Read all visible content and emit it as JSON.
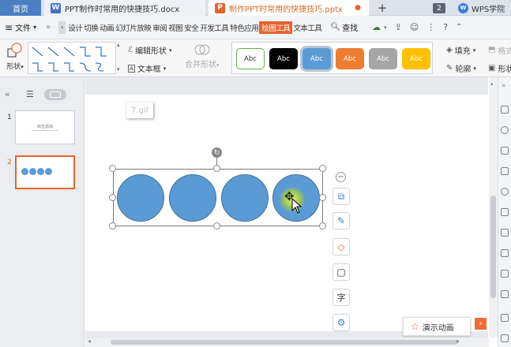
{
  "tabs": {
    "home": "首页",
    "docx": "PPT制作时常用的快捷技巧.docx",
    "pptx": "制作PPT时常用的快捷技巧.pptx",
    "count": "2",
    "wps": "WPS学院"
  },
  "menu": {
    "file": "文件",
    "tabs": [
      "设计",
      "切换",
      "动画",
      "幻灯片放映",
      "审阅",
      "视图",
      "安全",
      "开发工具",
      "特色应用",
      "绘图工具",
      "文本工具"
    ],
    "active": "绘图工具",
    "search": "查找"
  },
  "ribbon": {
    "shapes": "形状",
    "edit_shape": "编辑形状",
    "textbox": "文本框",
    "merge_shape": "合并形状",
    "style_label": "Abc",
    "fill": "填充",
    "outline": "轮廓",
    "format": "格式",
    "shape_effect": "形状"
  },
  "styles": [
    {
      "bg": "#ffffff",
      "border": "#6aa84f",
      "fg": "#333333"
    },
    {
      "bg": "#000000",
      "border": "#000000",
      "fg": "#ffffff"
    },
    {
      "bg": "#5b9bd5",
      "border": "#41719c",
      "fg": "#ffffff"
    },
    {
      "bg": "#ed7d31",
      "border": "#c55a11",
      "fg": "#ffffff"
    },
    {
      "bg": "#a5a5a5",
      "border": "#7f7f7f",
      "fg": "#ffffff"
    },
    {
      "bg": "#ffc000",
      "border": "#bf9000",
      "fg": "#ffffff"
    }
  ],
  "slides": [
    {
      "num": "1",
      "title": "双击添加"
    },
    {
      "num": "2",
      "title": ""
    }
  ],
  "canvas": {
    "gif_label": "7.gif"
  },
  "demo": {
    "label": "演示动画"
  },
  "colors": {
    "accent": "#e7632f",
    "shape_fill": "#5b9bd5",
    "tab_home": "#4a7fc1"
  }
}
